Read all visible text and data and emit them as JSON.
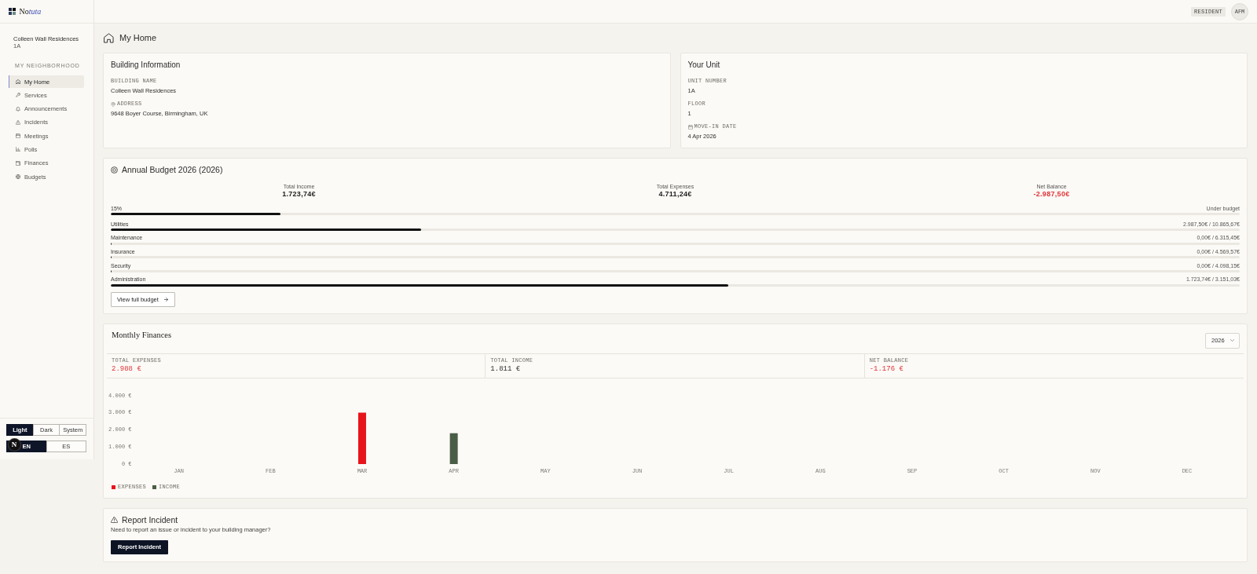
{
  "sidebar": {
    "logo": {
      "plain": "No",
      "accent": "tuta"
    },
    "org_name": "Colleen Wall Residences",
    "unit": "1A",
    "section_label": "MY NEIGHBORHOOD",
    "items": [
      {
        "label": "My Home",
        "selected": true
      },
      {
        "label": "Services",
        "selected": false
      },
      {
        "label": "Announcements",
        "selected": false
      },
      {
        "label": "Incidents",
        "selected": false
      },
      {
        "label": "Meetings",
        "selected": false
      },
      {
        "label": "Polls",
        "selected": false
      },
      {
        "label": "Finances",
        "selected": false
      },
      {
        "label": "Budgets",
        "selected": false
      }
    ],
    "theme_options": [
      {
        "label": "Light",
        "selected": true
      },
      {
        "label": "Dark",
        "selected": false
      },
      {
        "label": "System",
        "selected": false
      }
    ],
    "language_options": [
      {
        "label": "EN",
        "selected": true
      },
      {
        "label": "ES",
        "selected": false
      }
    ]
  },
  "dev_badge": {
    "label": "N"
  },
  "top_bar": {
    "role_badge": "RESIDENT",
    "avatar": "AFM"
  },
  "page": {
    "title": "My Home"
  },
  "building_info": {
    "title": "Building Information",
    "fields": [
      {
        "kind": "plain",
        "label": "BUILDING NAME",
        "value": "Colleen Wall Residences"
      },
      {
        "kind": "address",
        "label": "ADDRESS",
        "value": "9648 Boyer Course, Birmingham, UK"
      }
    ]
  },
  "your_unit": {
    "title": "Your Unit",
    "fields": [
      {
        "kind": "plain",
        "label": "UNIT NUMBER",
        "value": "1A"
      },
      {
        "kind": "plain",
        "label": "FLOOR",
        "value": "1"
      },
      {
        "kind": "date",
        "label": "MOVE-IN DATE",
        "value": "4 Apr 2026"
      }
    ]
  },
  "annual_budget": {
    "title": "Annual Budget 2026 (2026)",
    "stats": [
      {
        "label": "Total Income",
        "value": "1.723,74€",
        "negative": false
      },
      {
        "label": "Total Expenses",
        "value": "4.711,24€",
        "negative": false
      },
      {
        "label": "Net Balance",
        "value": "-2.987,50€",
        "negative": true
      }
    ],
    "summary": {
      "label": "15%",
      "status": "Under budget",
      "level": 0.15
    },
    "categories": [
      {
        "name": "Utilities",
        "amount": "2.987,50€ / 10.865,67€",
        "level": 0.275
      },
      {
        "name": "Maintenance",
        "amount": "0,00€ / 6.315,45€",
        "level": 0
      },
      {
        "name": "Insurance",
        "amount": "0,00€ / 4.569,57€",
        "level": 0
      },
      {
        "name": "Security",
        "amount": "0,00€ / 4.098,15€",
        "level": 0
      },
      {
        "name": "Administration",
        "amount": "1.723,74€ / 3.151,03€",
        "level": 0.547
      }
    ],
    "button": "View full budget"
  },
  "monthly_finances": {
    "title": "Monthly Finances",
    "year": "2026",
    "stats": [
      {
        "label": "TOTAL EXPENSES",
        "value": "2.988 €",
        "negative": true
      },
      {
        "label": "TOTAL INCOME",
        "value": "1.811 €",
        "negative": false
      },
      {
        "label": "NET BALANCE",
        "value": "-1.176 €",
        "negative": true
      }
    ],
    "chart_data": {
      "type": "bar",
      "categories": [
        "JAN",
        "FEB",
        "MAR",
        "APR",
        "MAY",
        "JUN",
        "JUL",
        "AUG",
        "SEP",
        "OCT",
        "NOV",
        "DEC"
      ],
      "series": [
        {
          "name": "EXPENSES",
          "color": "#e8141c",
          "values": [
            0,
            0,
            3000,
            0,
            0,
            0,
            0,
            0,
            0,
            0,
            0,
            0
          ]
        },
        {
          "name": "INCOME",
          "color": "#4a5d45",
          "values": [
            0,
            0,
            0,
            1800,
            0,
            0,
            0,
            0,
            0,
            0,
            0,
            0
          ]
        }
      ],
      "ylim": [
        0,
        4000
      ],
      "yticks": [
        {
          "value": 0,
          "label": "0 €"
        },
        {
          "value": 1000,
          "label": "1.000 €"
        },
        {
          "value": 2000,
          "label": "2.000 €"
        },
        {
          "value": 3000,
          "label": "3.000 €"
        },
        {
          "value": 4000,
          "label": "4.000 €"
        }
      ]
    }
  },
  "report_incident": {
    "title": "Report Incident",
    "text": "Need to report an issue or incident to your building manager?",
    "button": "Report Incident"
  }
}
